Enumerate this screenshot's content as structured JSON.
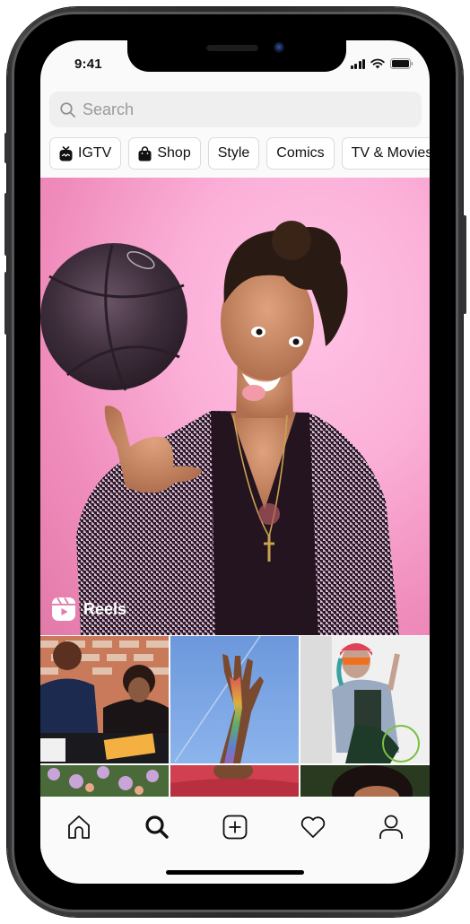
{
  "status_bar": {
    "time": "9:41",
    "icons": [
      "cellular-signal-icon",
      "wifi-icon",
      "battery-icon"
    ]
  },
  "search": {
    "placeholder": "Search",
    "value": "",
    "icon": "search-icon"
  },
  "categories": [
    {
      "label": "IGTV",
      "icon": "igtv-icon"
    },
    {
      "label": "Shop",
      "icon": "shopping-bag-icon"
    },
    {
      "label": "Style",
      "icon": null
    },
    {
      "label": "Comics",
      "icon": null
    },
    {
      "label": "TV & Movies",
      "icon": null
    }
  ],
  "featured": {
    "label": "Reels",
    "icon": "reels-icon",
    "description": "Woman in houndstooth blazer spinning basketball on finger against pink background"
  },
  "grid": [
    {
      "description": "Two people painting at a table in front of a brick wall"
    },
    {
      "description": "Raised hand decorated with rainbow rhinestones against blue sky"
    },
    {
      "description": "Person in red beanie and sunglasses with denim jacket in wheelchair"
    },
    {
      "description": "Purple flowers"
    },
    {
      "description": "Person in red hoodie"
    },
    {
      "description": "Close-up of person with dark hair"
    }
  ],
  "tab_bar": [
    {
      "name": "home",
      "icon": "home-icon",
      "active": false
    },
    {
      "name": "search",
      "icon": "search-icon",
      "active": true
    },
    {
      "name": "new-post",
      "icon": "add-post-icon",
      "active": false
    },
    {
      "name": "activity",
      "icon": "heart-icon",
      "active": false
    },
    {
      "name": "profile",
      "icon": "profile-icon",
      "active": false
    }
  ],
  "colors": {
    "hero_background": "#f6a9d2",
    "search_background": "#efefef",
    "chip_border": "#dbdbdb",
    "screen_background": "#fafafa"
  }
}
